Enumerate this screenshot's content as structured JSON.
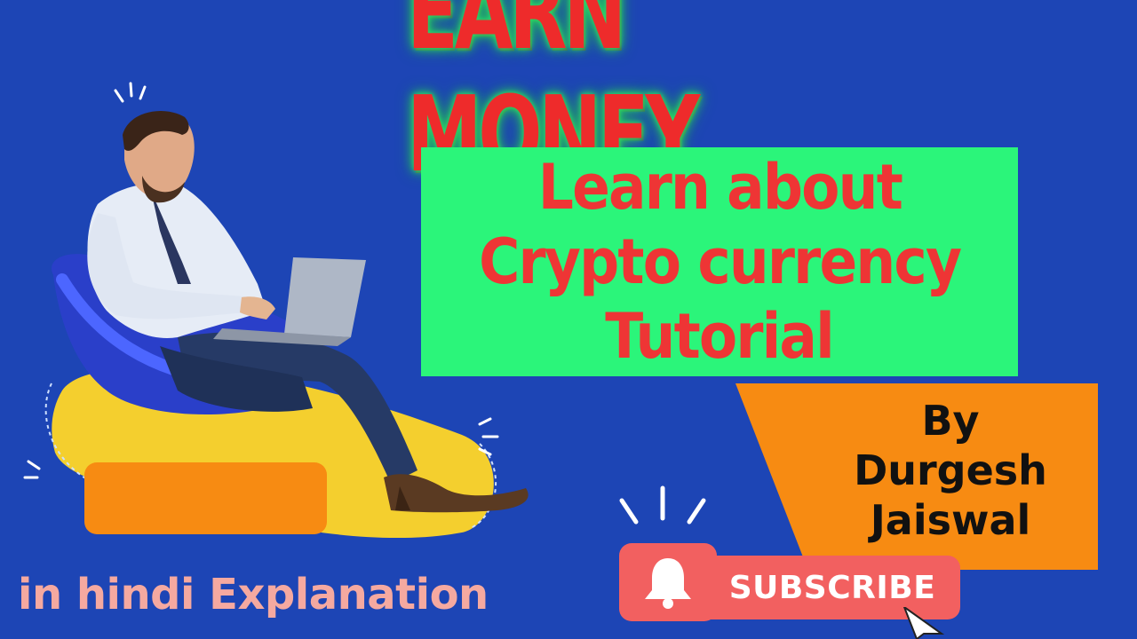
{
  "headline": "EARN MONEY",
  "topic": {
    "line1": "Learn about",
    "line2": "Crypto currency",
    "line3": "Tutorial"
  },
  "byline": {
    "by": "By",
    "first": "Durgesh",
    "last": "Jaiswal"
  },
  "bottom_text": "in hindi Explanation",
  "subscribe": {
    "label": "SUBSCRIBE",
    "icon": "bell-icon"
  },
  "colors": {
    "background": "#1d45b5",
    "green_box": "#2bf57a",
    "red_text": "#ee2b2b",
    "orange": "#f78b12",
    "subscribe": "#f26060",
    "pink_text": "#f5a9a0"
  }
}
